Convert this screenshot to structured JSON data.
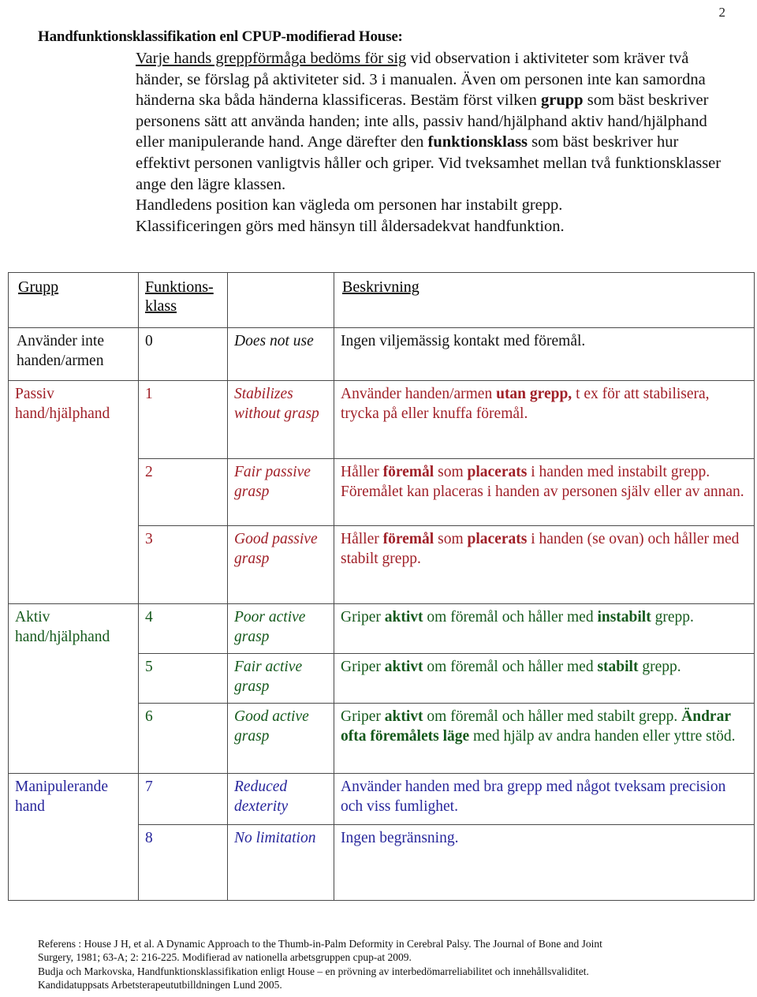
{
  "page": {
    "number": "2"
  },
  "intro": {
    "title": "Handfunktionsklassifikation enl CPUP-modifierad House:",
    "underlined_lead": "Varje hands greppförmåga bedöms för sig",
    "body_1": " vid observation i aktiviteter som kräver två händer, se förslag på aktiviteter sid. 3 i manualen. Även om personen inte kan samordna händerna ska båda händerna klassificeras. Bestäm först vilken ",
    "bold_1": "grupp",
    "body_2": " som bäst beskriver personens sätt att använda handen; inte alls, passiv hand/hjälphand aktiv hand/hjälphand eller manipulerande hand. Ange därefter den ",
    "bold_2": "funktionsklass",
    "body_3": " som bäst beskriver hur effektivt personen vanligtvis håller och griper. Vid tveksamhet mellan två funktionsklasser ange den lägre klassen.",
    "line_wrist": "Handledens position kan vägleda om personen har instabilt grepp.",
    "line_age": "Klassificeringen görs med hänsyn till åldersadekvat handfunktion."
  },
  "table": {
    "headers": {
      "group": "Grupp",
      "class_line1": "Funktions-",
      "class_line2": "klass",
      "english": "",
      "description": "Beskrivning"
    },
    "groups": [
      {
        "id": "anvander-inte",
        "label": "Använder inte handen/armen",
        "color": "#111111",
        "rowspan": 1
      },
      {
        "id": "passiv",
        "label": "Passiv hand/hjälphand",
        "color": "#A02028",
        "rowspan": 3
      },
      {
        "id": "aktiv",
        "label": "Aktiv hand/hjälphand",
        "color": "#15591C",
        "rowspan": 3
      },
      {
        "id": "manipulerande",
        "label": "Manipulerande hand",
        "color": "#27269B",
        "rowspan": 2
      }
    ],
    "rows": [
      {
        "class": "0",
        "english": "Does not use",
        "desc_plain": "Ingen viljemässig kontakt med föremål.",
        "color": "#111111"
      },
      {
        "class": "1",
        "english": "Stabilizes without grasp",
        "desc_pre": "Använder handen/armen ",
        "desc_bold": "utan grepp,",
        "desc_post": " t ex för att stabilisera, trycka på eller knuffa föremål.",
        "color": "#A02028"
      },
      {
        "class": "2",
        "english": "Fair passive grasp",
        "desc_pre": "Håller ",
        "desc_bold": "föremål",
        "desc_mid": " som ",
        "desc_bold2": "placerats",
        "desc_post": " i handen med instabilt grepp. Föremålet kan placeras i handen av personen själv eller av annan.",
        "color": "#A02028"
      },
      {
        "class": "3",
        "english": "Good passive grasp",
        "desc_pre": "Håller ",
        "desc_bold": "föremål",
        "desc_mid": " som ",
        "desc_bold2": "placerats",
        "desc_post": " i handen (se ovan) och håller med stabilt grepp.",
        "color": "#A02028"
      },
      {
        "class": "4",
        "english": "Poor active grasp",
        "desc_pre": "Griper ",
        "desc_bold": "aktivt",
        "desc_mid": " om föremål och håller med ",
        "desc_bold2": "instabilt",
        "desc_post": " grepp.",
        "color": "#15591C"
      },
      {
        "class": "5",
        "english": "Fair active grasp",
        "desc_pre": "Griper ",
        "desc_bold": "aktivt",
        "desc_mid": " om föremål och håller med ",
        "desc_bold2": "stabilt",
        "desc_post": " grepp.",
        "color": "#15591C"
      },
      {
        "class": "6",
        "english": "Good active grasp",
        "desc_pre": "Griper ",
        "desc_bold": "aktivt",
        "desc_mid": " om föremål och håller med stabilt grepp. ",
        "desc_bold2": "Ändrar ofta föremålets läge",
        "desc_post": " med hjälp av andra handen eller yttre stöd.",
        "color": "#15591C"
      },
      {
        "class": "7",
        "english": "Reduced dexterity",
        "desc_plain": "Använder handen med bra grepp med något tveksam precision och viss fumlighet.",
        "color": "#27269B"
      },
      {
        "class": "8",
        "english": "No limitation",
        "desc_plain": "Ingen begränsning.",
        "color": "#27269B"
      }
    ]
  },
  "footer": {
    "line1": "Referens : House J H, et al. A Dynamic Approach to the Thumb-in-Palm Deformity in Cerebral Palsy. The Journal of Bone and Joint",
    "line2": "Surgery, 1981; 63-A; 2: 216-225.  Modifierad av nationella arbetsgruppen cpup-at 2009.",
    "line3": "Budja och Markovska, Handfunktionsklassifikation enligt House – en prövning av interbedömarreliabilitet och innehållsvaliditet.",
    "line4": "Kandidatuppsats Arbetsterapeututbilldningen Lund 2005."
  }
}
